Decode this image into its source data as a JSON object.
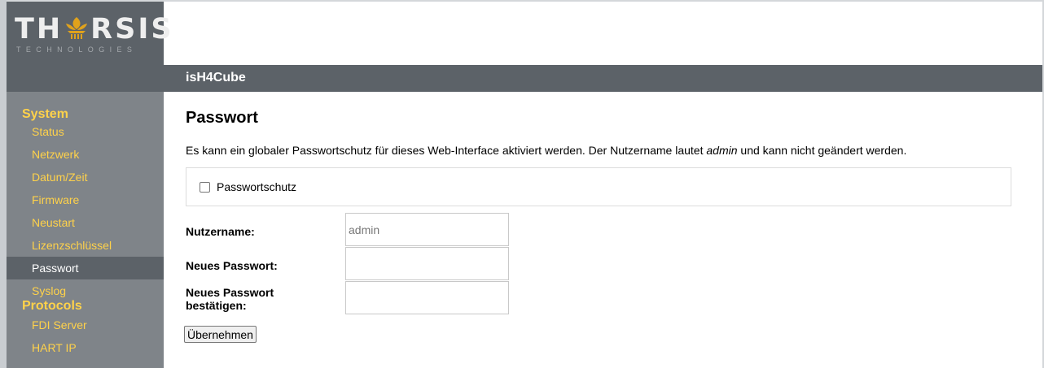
{
  "brand": {
    "logo_text_left": "TH",
    "logo_text_right": "RSIS",
    "logo_subtitle": "TECHNOLOGIES",
    "emblem_icon": "lotus-emblem-icon",
    "emblem_color": "#e0a21c"
  },
  "header": {
    "title": "isH4Cube"
  },
  "sidebar": {
    "sections": [
      {
        "label": "System",
        "items": [
          {
            "label": "Status",
            "active": false
          },
          {
            "label": "Netzwerk",
            "active": false
          },
          {
            "label": "Datum/Zeit",
            "active": false
          },
          {
            "label": "Firmware",
            "active": false
          },
          {
            "label": "Neustart",
            "active": false
          },
          {
            "label": "Lizenzschlüssel",
            "active": false
          },
          {
            "label": "Passwort",
            "active": true
          },
          {
            "label": "Syslog",
            "active": false
          }
        ]
      },
      {
        "label": "Protocols",
        "items": [
          {
            "label": "FDI Server",
            "active": false
          },
          {
            "label": "HART IP",
            "active": false
          }
        ]
      }
    ]
  },
  "main": {
    "title": "Passwort",
    "description_before": "Es kann ein globaler Passwortschutz für dieses Web-Interface aktiviert werden. Der Nutzername lautet ",
    "description_emphasis": "admin",
    "description_after": " und kann nicht geändert werden.",
    "password_protection": {
      "label": "Passwortschutz",
      "checked": false
    },
    "form": {
      "username_label": "Nutzername:",
      "username_placeholder": "admin",
      "username_value": "",
      "new_password_label": "Neues Passwort:",
      "new_password_value": "",
      "confirm_label_line1": "Neues Passwort",
      "confirm_label_line2": "bestätigen:",
      "confirm_value": "",
      "submit_label": "Übernehmen"
    }
  },
  "colors": {
    "nav_text": "#ffd24a",
    "nav_active_text": "#ffffff",
    "sidebar_bg": "#7f8489",
    "header_bg": "#5c6268"
  }
}
